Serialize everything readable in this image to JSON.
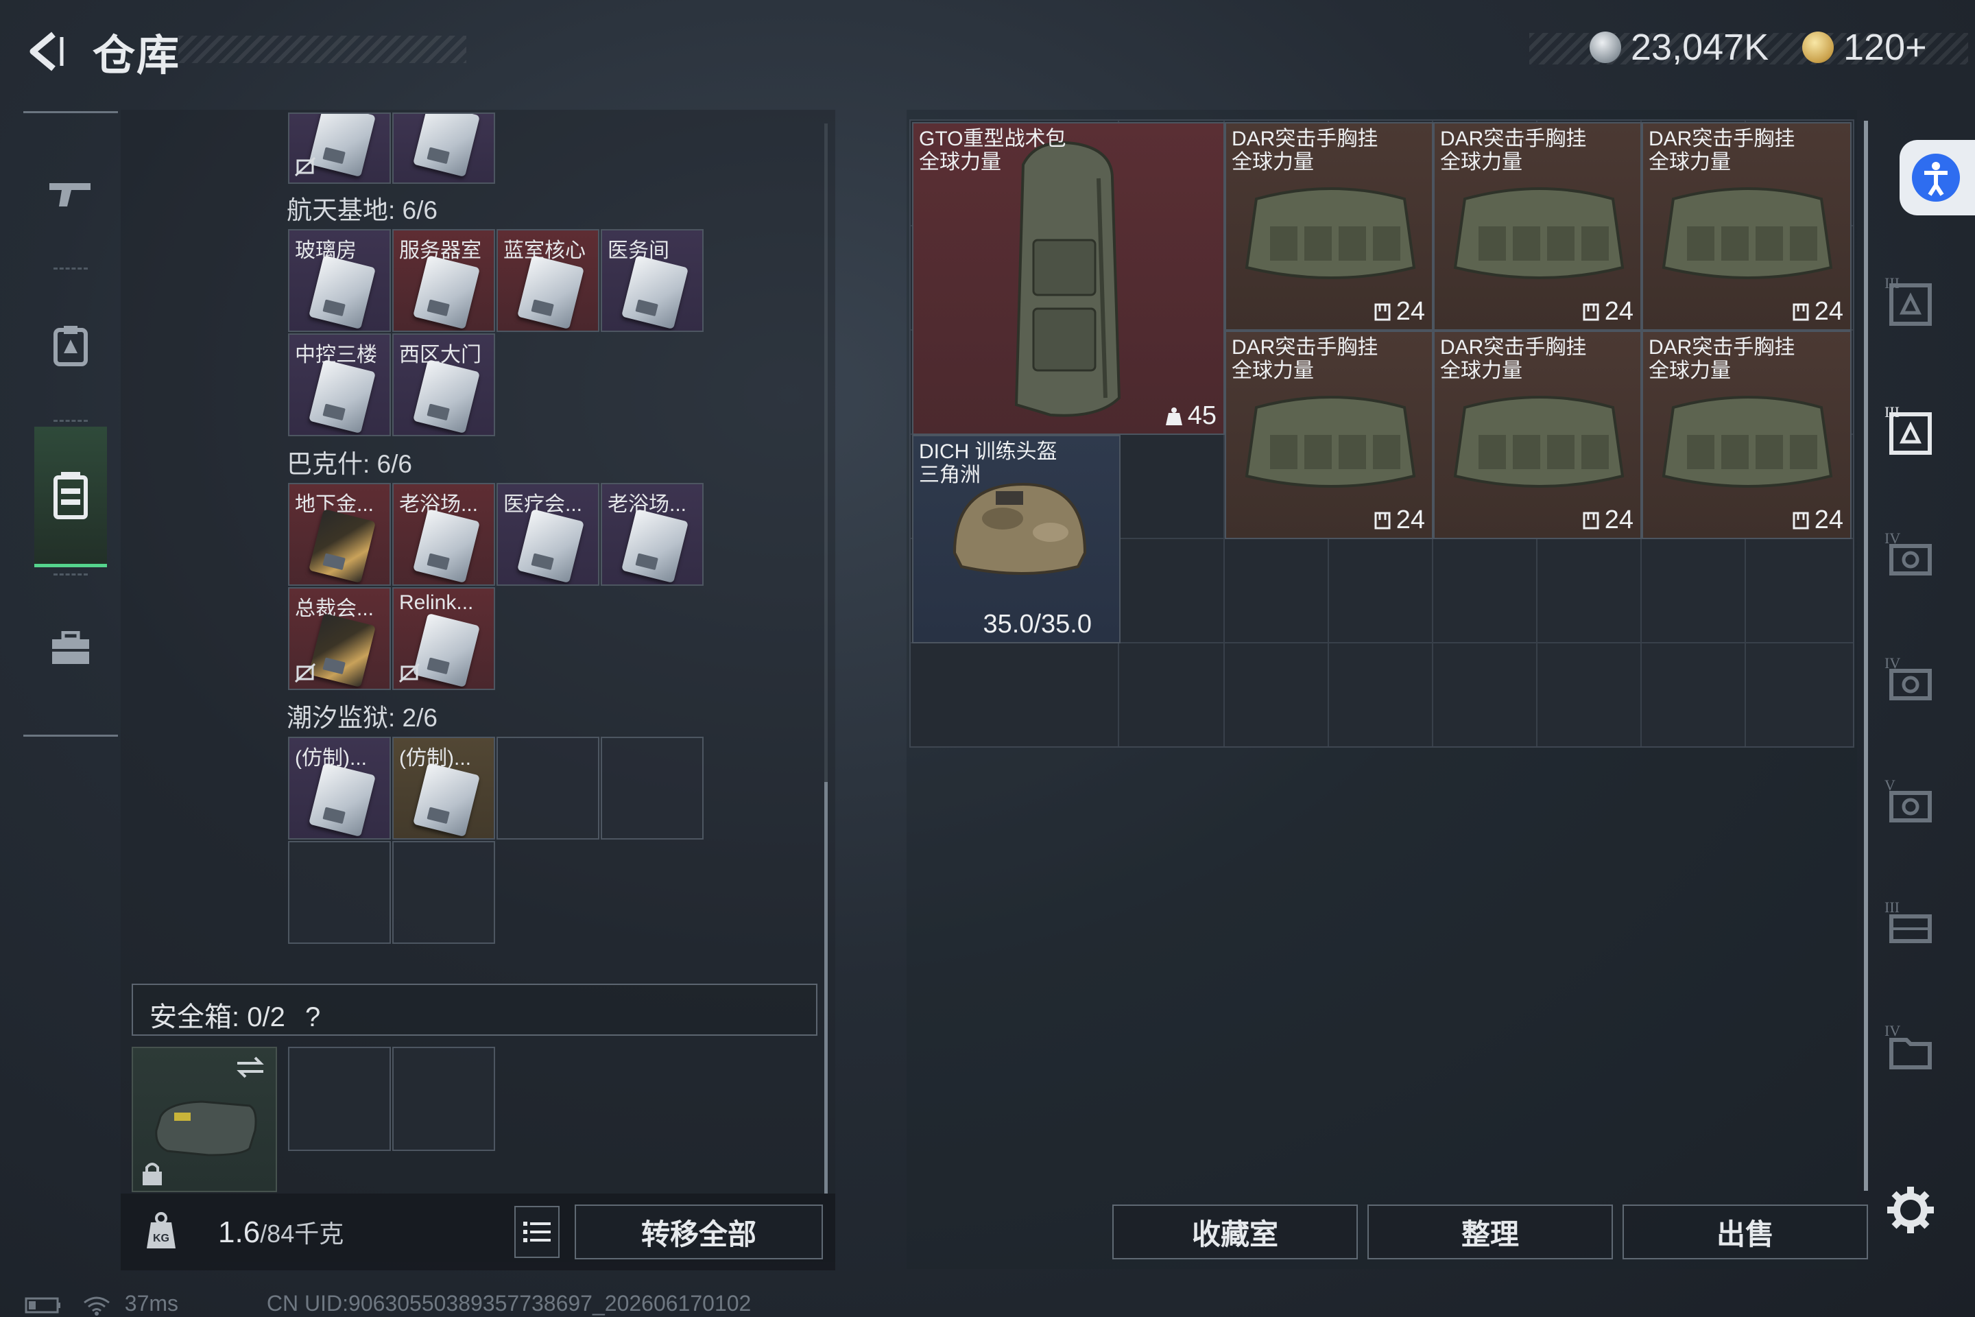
{
  "header": {
    "title": "仓库",
    "currency_primary": "23,047K",
    "currency_secondary": "120+"
  },
  "nav": {
    "items": [
      {
        "name": "weapons",
        "icon": "gun-icon"
      },
      {
        "name": "equipment",
        "icon": "vest-icon"
      },
      {
        "name": "warehouse",
        "icon": "backpack-icon",
        "active": true
      },
      {
        "name": "toolbox",
        "icon": "briefcase-icon"
      }
    ]
  },
  "keycards": {
    "sections": [
      {
        "label": "航天基地: 6/6",
        "cells": [
          {
            "label": "玻璃房",
            "rarity": "purple"
          },
          {
            "label": "服务器室",
            "rarity": "red"
          },
          {
            "label": "蓝室核心",
            "rarity": "red"
          },
          {
            "label": "医务间",
            "rarity": "purple"
          },
          {
            "label": "中控三楼",
            "rarity": "purple"
          },
          {
            "label": "西区大门",
            "rarity": "purple"
          }
        ]
      },
      {
        "label": "巴克什: 6/6",
        "cells": [
          {
            "label": "地下金...",
            "rarity": "red"
          },
          {
            "label": "老浴场...",
            "rarity": "red"
          },
          {
            "label": "医疗会...",
            "rarity": "purple"
          },
          {
            "label": "老浴场...",
            "rarity": "purple"
          },
          {
            "label": "总裁会...",
            "rarity": "red"
          },
          {
            "label": "Relink...",
            "rarity": "red"
          }
        ]
      },
      {
        "label": "潮汐监狱: 2/6",
        "cells": [
          {
            "label": "(仿制)...",
            "rarity": "purple"
          },
          {
            "label": "(仿制)...",
            "rarity": "gold"
          }
        ]
      }
    ]
  },
  "safebox": {
    "label": "安全箱: 0/2",
    "help": "?"
  },
  "footer_left": {
    "weight_current": "1.6",
    "weight_max": "/84千克",
    "transfer_all_label": "转移全部"
  },
  "stash": {
    "items": [
      {
        "name": "GTO重型战术包",
        "subtitle": "全球力量",
        "count": "45"
      },
      {
        "name": "DAR突击手胸挂",
        "subtitle": "全球力量",
        "count": "24"
      },
      {
        "name": "DAR突击手胸挂",
        "subtitle": "全球力量",
        "count": "24"
      },
      {
        "name": "DAR突击手胸挂",
        "subtitle": "全球力量",
        "count": "24"
      },
      {
        "name": "DAR突击手胸挂",
        "subtitle": "全球力量",
        "count": "24"
      },
      {
        "name": "DAR突击手胸挂",
        "subtitle": "全球力量",
        "count": "24"
      },
      {
        "name": "DAR突击手胸挂",
        "subtitle": "全球力量",
        "count": "24"
      },
      {
        "name": "DICH 训练头盔",
        "subtitle": "三角洲",
        "durability": "35.0/35.0"
      }
    ]
  },
  "footer_right": {
    "collection_label": "收藏室",
    "sort_label": "整理",
    "sell_label": "出售"
  },
  "status_bar": {
    "ping": "37ms",
    "uid": "CN UID:9063055038935773869​7_202606170102"
  }
}
